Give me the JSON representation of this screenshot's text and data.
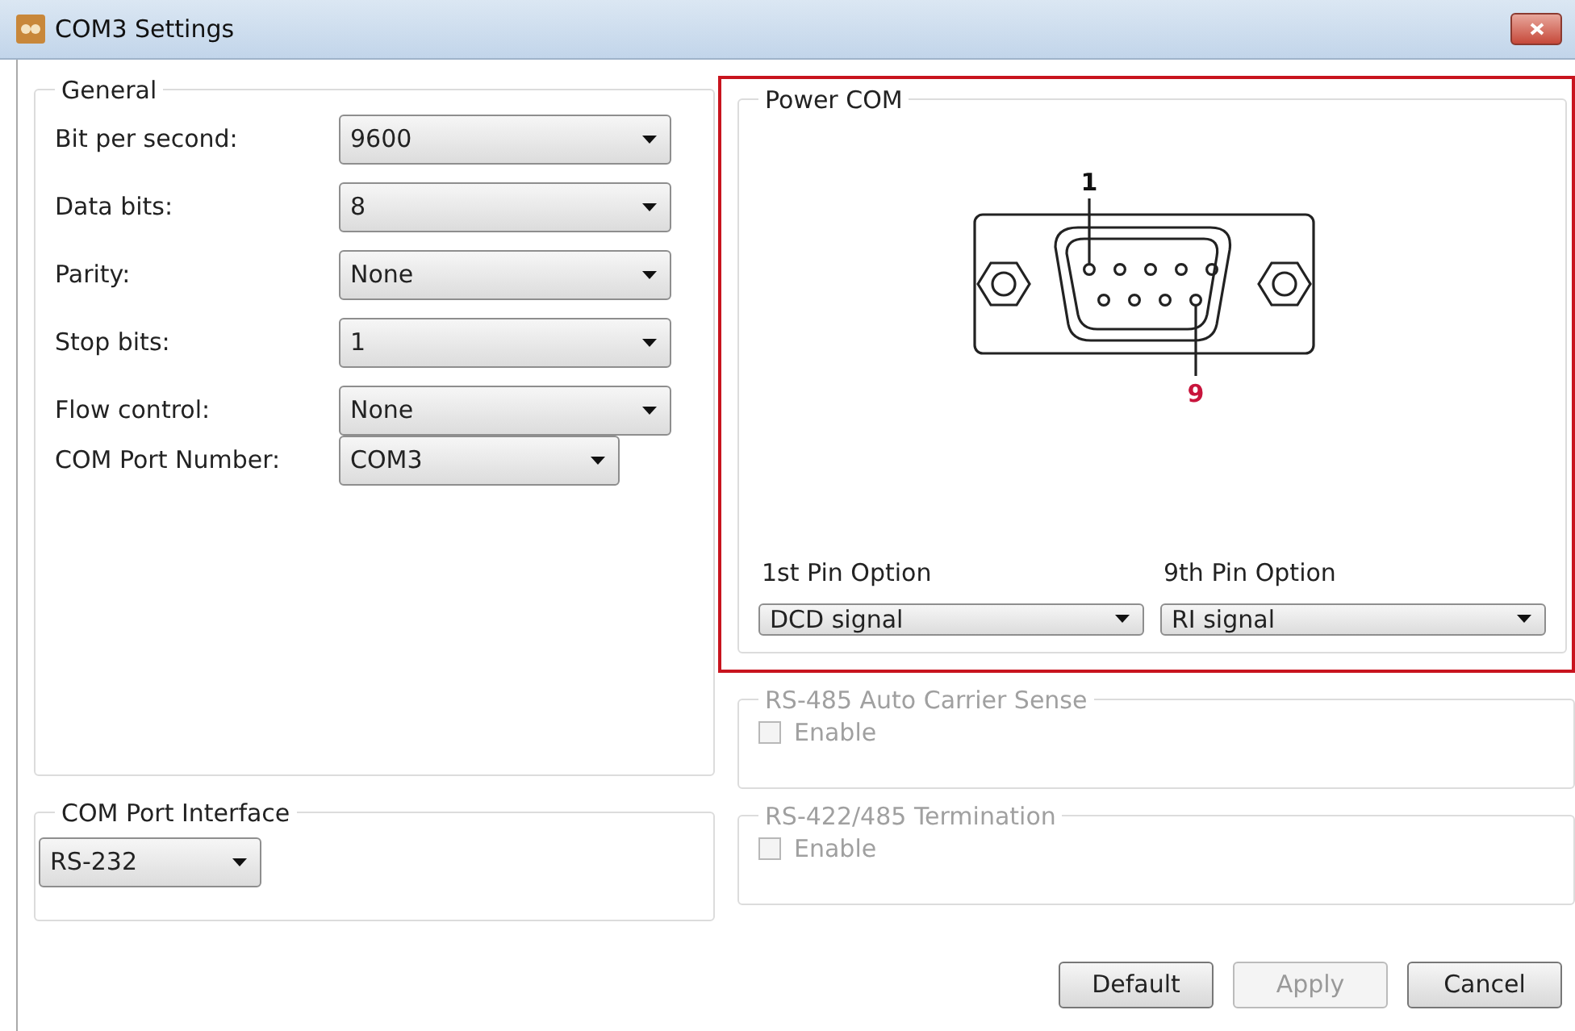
{
  "window": {
    "title": "COM3 Settings"
  },
  "general": {
    "title": "General",
    "fields": [
      {
        "label": "Bit per second:",
        "value": "9600"
      },
      {
        "label": "Data bits:",
        "value": "8"
      },
      {
        "label": "Parity:",
        "value": "None"
      },
      {
        "label": "Stop bits:",
        "value": "1"
      },
      {
        "label": "Flow control:",
        "value": "None"
      }
    ],
    "com_port_number": {
      "label": "COM Port Number:",
      "value": "COM3"
    }
  },
  "com_port_interface": {
    "title": "COM Port Interface",
    "value": "RS-232"
  },
  "power_com": {
    "title": "Power COM",
    "highlighted": true,
    "pin_first": "1",
    "pin_last": "9",
    "options": [
      {
        "label": "1st Pin Option",
        "value": "DCD signal"
      },
      {
        "label": "9th Pin Option",
        "value": "RI signal"
      }
    ]
  },
  "option_groups": [
    {
      "title": "RS-485 Auto Carrier Sense",
      "disabled": true,
      "checkbox": {
        "label": "Enable",
        "checked": false
      }
    },
    {
      "title": "RS-422/485 Termination",
      "disabled": true,
      "checkbox": {
        "label": "Enable",
        "checked": false
      }
    }
  ],
  "buttons": [
    {
      "label": "Default",
      "disabled": false
    },
    {
      "label": "Apply",
      "disabled": true
    },
    {
      "label": "Cancel",
      "disabled": false
    }
  ]
}
